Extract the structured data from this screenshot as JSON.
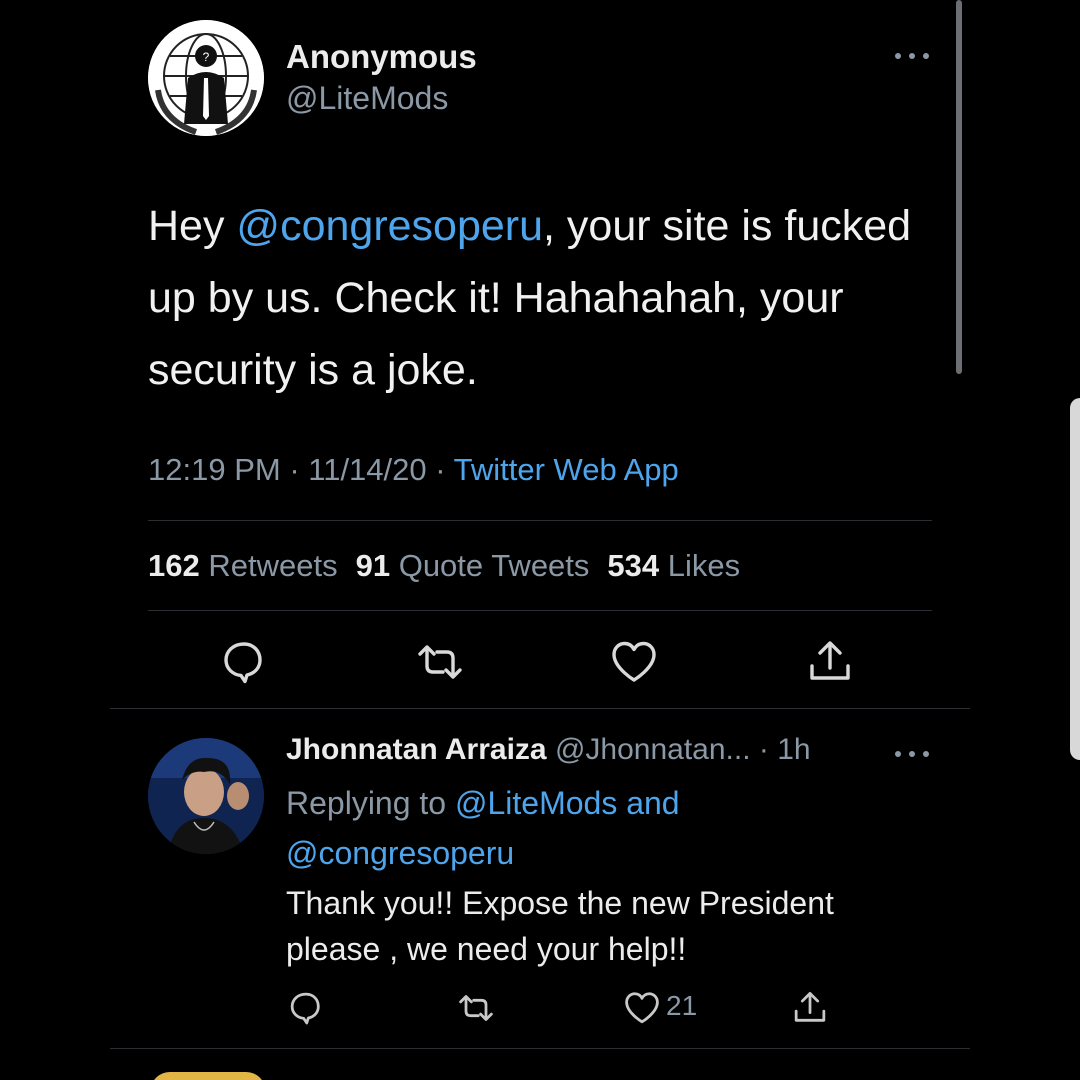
{
  "tweet": {
    "author_name": "Anonymous",
    "author_handle": "@LiteMods",
    "text_parts": {
      "prefix": "Hey ",
      "mention": "@congresoperu",
      "suffix": ", your site is fucked up by us. Check it! Hahahahah, your security is a joke."
    },
    "time": "12:19 PM",
    "date": "11/14/20",
    "separator": " · ",
    "source": "Twitter Web App",
    "stats": {
      "retweets_count": "162",
      "retweets_label": "Retweets",
      "quotes_count": "91",
      "quotes_label": "Quote Tweets",
      "likes_count": "534",
      "likes_label": "Likes"
    },
    "actions": [
      "reply-icon",
      "retweet-icon",
      "like-icon",
      "share-icon"
    ]
  },
  "reply": {
    "author_name": "Jhonnatan Arraiza",
    "author_handle": "@Jhonnatan...",
    "time_ago": " · 1h",
    "replying_prefix": "Replying to ",
    "replying_mention_1": "@LiteMods",
    "replying_and": " and",
    "replying_mention_2": "@congresoperu",
    "text": "Thank you!! Expose the new President please , we need your help!!",
    "like_count": "21",
    "actions": [
      "reply-icon",
      "retweet-icon",
      "like-icon",
      "share-icon"
    ]
  },
  "colors": {
    "background": "#000000",
    "accent": "#4ea5ec",
    "secondary_text": "#8b98a5",
    "primary_text": "#f1f1f1"
  }
}
